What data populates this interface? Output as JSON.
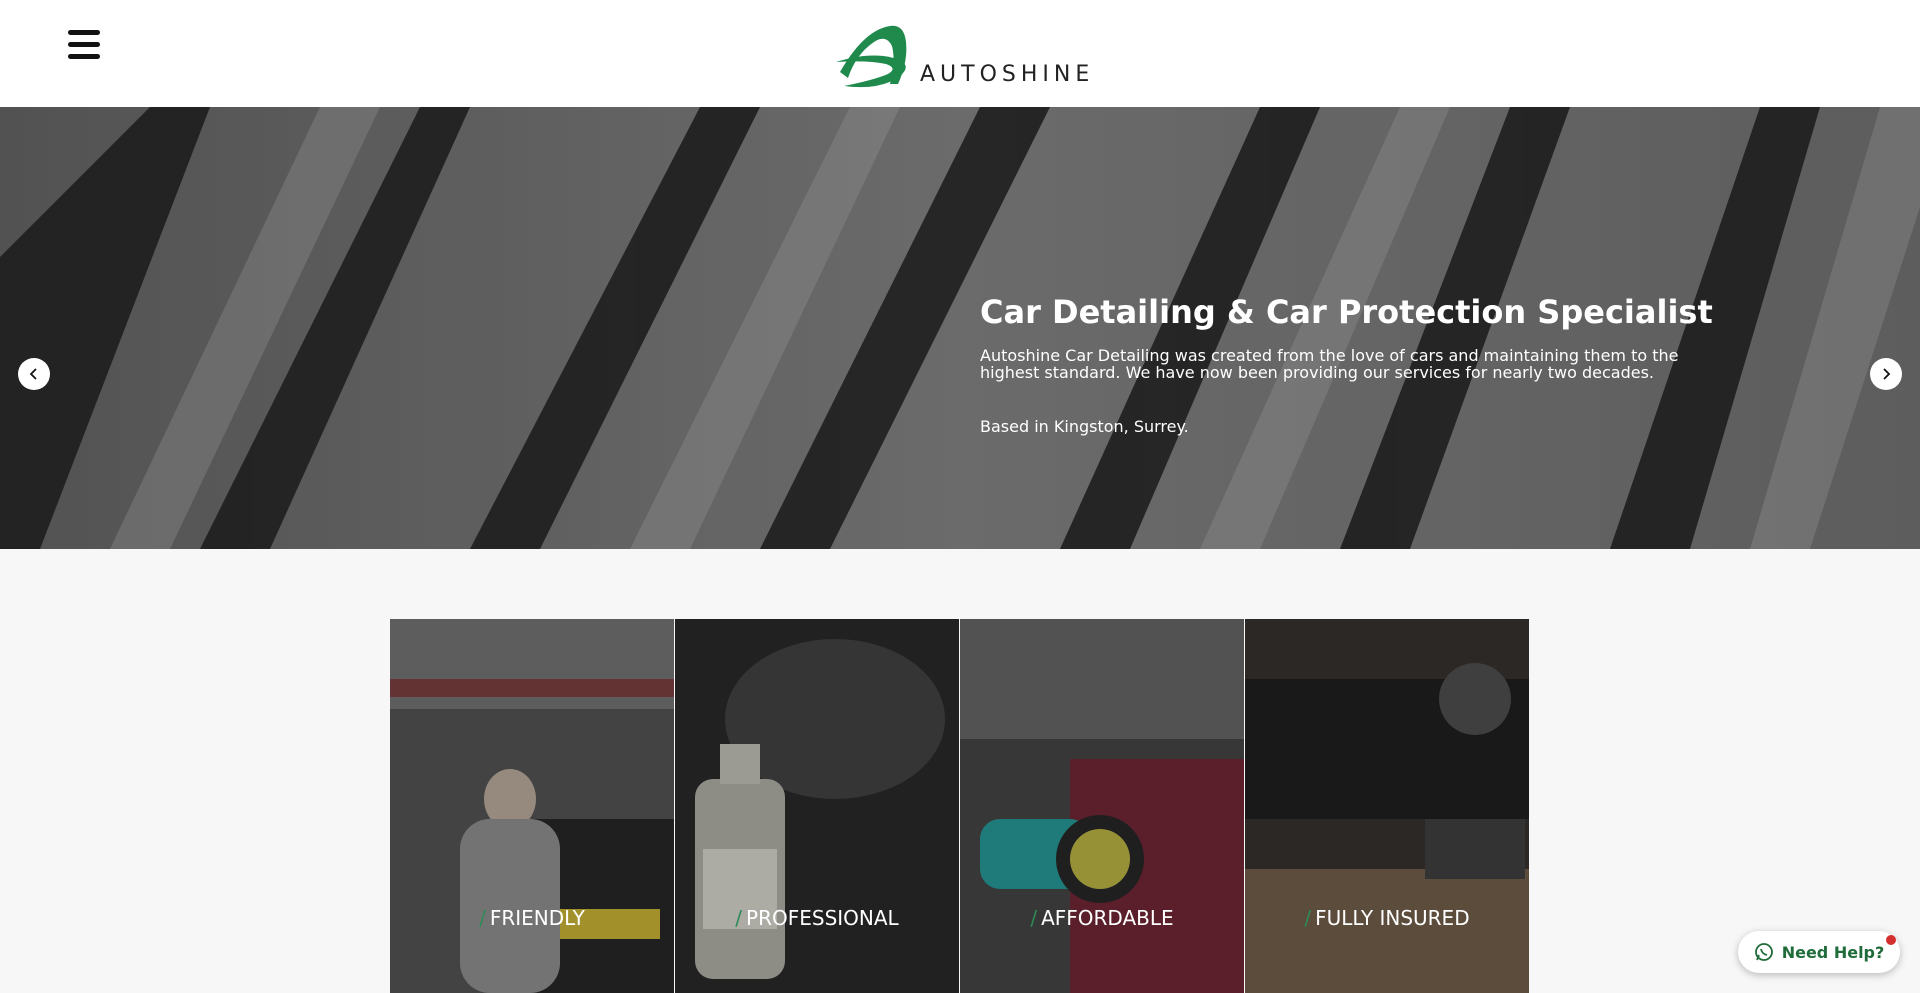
{
  "header": {
    "menu_icon": "hamburger-menu-icon",
    "logo_text": "AUTOSHINE",
    "brand_color": "#1f8a4c"
  },
  "hero": {
    "title": "Car Detailing & Car Protection Specialist",
    "description": "Autoshine Car Detailing was created from the love of cars and maintaining them to the highest standard. We have now been providing our services for nearly two decades.",
    "location": "Based in Kingston, Surrey.",
    "prev_icon": "chevron-left-icon",
    "next_icon": "chevron-right-icon"
  },
  "features": [
    {
      "label": "FRIENDLY"
    },
    {
      "label": "PROFESSIONAL"
    },
    {
      "label": "AFFORDABLE"
    },
    {
      "label": "FULLY INSURED"
    }
  ],
  "feature_slash": "/",
  "help": {
    "label": "Need Help?",
    "icon": "whatsapp-icon",
    "badge_color": "#d32f2f"
  }
}
